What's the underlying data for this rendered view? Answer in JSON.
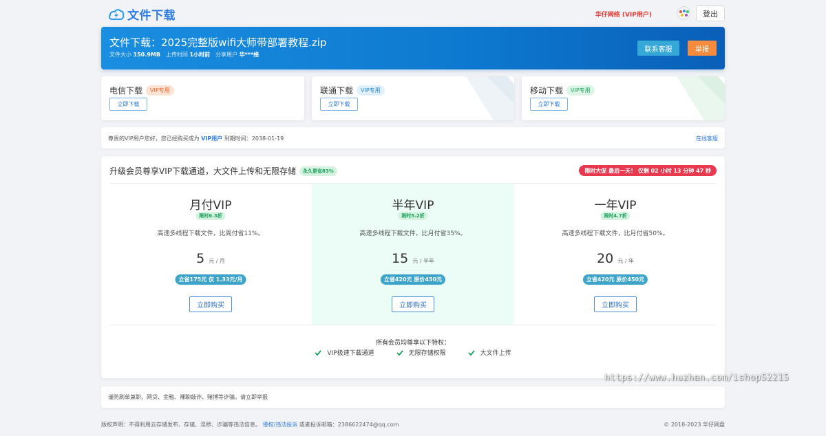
{
  "header": {
    "logo_text": "文件下载",
    "user_name": "华仔网络 (VIP用户)",
    "logout_label": "登出"
  },
  "banner": {
    "title": "文件下载：2025完整版wifi大师带部署教程.zip",
    "size_label": "文件大小",
    "size_value": "150.9MB",
    "time_label": "上传时间",
    "time_value": "1小时前",
    "sharer_label": "分享用户",
    "sharer_value": "华***络",
    "contact_label": "联系客服",
    "report_label": "举报"
  },
  "download_cards": [
    {
      "title": "电信下载",
      "tag": "VIP专用",
      "button": "立即下载"
    },
    {
      "title": "联通下载",
      "tag": "VIP专用",
      "button": "立即下载"
    },
    {
      "title": "移动下载",
      "tag": "VIP专用",
      "button": "立即下载"
    }
  ],
  "notice": {
    "prefix": "尊贵的VIP用户您好，您已经购买成为",
    "vip": "VIP用户",
    "suffix": "到期时间：2038-01-19",
    "link": "在线客服"
  },
  "upgrade": {
    "title": "升级会员尊享VIP下载通道，大文件上传和无限存储",
    "badge": "永久更省83%",
    "promo": "限时大促 最后一天！ 仅剩 02 小时 13 分钟 47 秒",
    "plans": [
      {
        "name": "月付VIP",
        "discount": "限时6.3折",
        "desc": "高速多线程下载文件，比周付省11%。",
        "price": "5",
        "unit": "元 / 月",
        "save": "立省175元 仅 1.33元/月",
        "button": "立即购买"
      },
      {
        "name": "半年VIP",
        "discount": "限时5.2折",
        "desc": "高速多线程下载文件，比月付省35%。",
        "price": "15",
        "unit": "元 / 半年",
        "save": "立省420元 原价450元",
        "button": "立即购买"
      },
      {
        "name": "一年VIP",
        "discount": "限时4.7折",
        "desc": "高速多线程下载文件，比月付省50%。",
        "price": "20",
        "unit": "元 / 年",
        "save": "立省420元 原价450元",
        "button": "立即购买"
      }
    ],
    "perks_title": "所有会员均尊享以下特权：",
    "perks": [
      "VIP极速下载通道",
      "无限存储权限",
      "大文件上传"
    ]
  },
  "warning": "谨防刷单兼职、网贷、金融、裸聊敲诈、赌博等诈骗，请立即举报",
  "footer": {
    "left_prefix": "版权声明：不得利用云存储发布、存储、淫秽、诈骗等违法信息。",
    "left_link": "侵权/违法投诉",
    "left_suffix": "或者投诉邮箱：2386622474@qq.com",
    "right": "© 2018-2023 华仔网盘"
  },
  "watermark": "https://www.huzhan.com/ishop52215",
  "colors": {
    "primary": "#2d7be5",
    "banner": "#0d78cf",
    "contact": "#36a8d8",
    "report": "#f58b3c",
    "promo": "#e8394f",
    "highlight": "#ecfcf6"
  }
}
